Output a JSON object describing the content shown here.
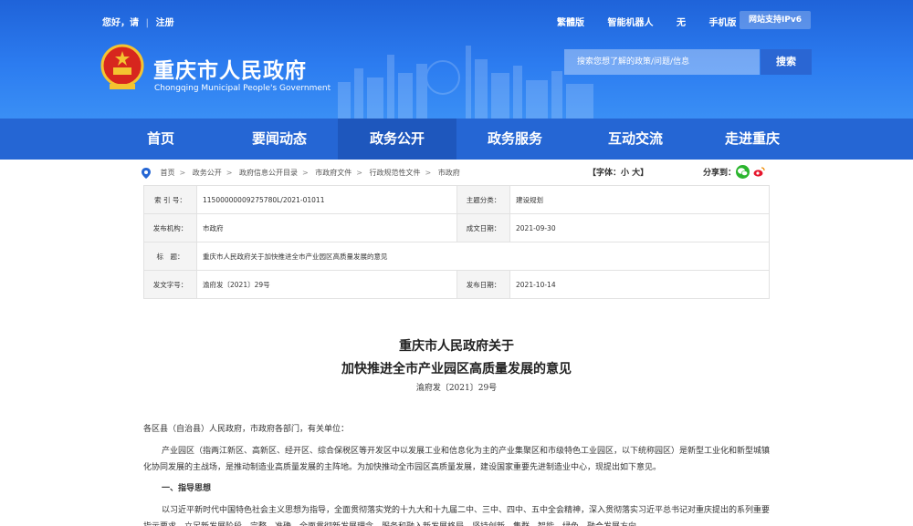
{
  "topbar": {
    "greeting": "您好，请",
    "register": "注册",
    "links": [
      "繁體版",
      "智能机器人",
      "无",
      "手机版"
    ],
    "ipv6": "网站支持IPv6"
  },
  "logo": {
    "cn": "重庆市人民政府",
    "en": "Chongqing Municipal People's Government"
  },
  "search": {
    "placeholder": "搜索您想了解的政策/问题/信息",
    "button": "搜索"
  },
  "nav": [
    "首页",
    "要闻动态",
    "政务公开",
    "政务服务",
    "互动交流",
    "走进重庆"
  ],
  "breadcrumb": [
    "首页",
    "政务公开",
    "政府信息公开目录",
    "市政府文件",
    "行政规范性文件",
    "市政府"
  ],
  "fontsize": "【字体：小 大】",
  "share_label": "分享到：",
  "meta": {
    "index_label": "索 引 号：",
    "index_value": "11500000009275780L/2021-01011",
    "topic_label": "主题分类：",
    "topic_value": "建设规划",
    "org_label": "发布机构：",
    "org_value": "市政府",
    "created_label": "成文日期：",
    "created_value": "2021-09-30",
    "title_label": "标　题：",
    "title_value": "重庆市人民政府关于加快推进全市产业园区高质量发展的意见",
    "docno_label": "发文字号：",
    "docno_value": "渝府发〔2021〕29号",
    "pub_label": "发布日期：",
    "pub_value": "2021-10-14"
  },
  "article": {
    "title1": "重庆市人民政府关于",
    "title2": "加快推进全市产业园区高质量发展的意见",
    "docno": "渝府发〔2021〕29号",
    "address": "各区县（自治县）人民政府，市政府各部门，有关单位：",
    "intro": "产业园区（指两江新区、高新区、经开区、综合保税区等开发区中以发展工业和信息化为主的产业集聚区和市级特色工业园区，以下统称园区）是新型工业化和新型城镇化协同发展的主战场，是推动制造业高质量发展的主阵地。为加快推动全市园区高质量发展，建设国家重要先进制造业中心，现提出如下意见。",
    "heading1": "一、指导思想",
    "body": "以习近平新时代中国特色社会主义思想为指导，全面贯彻落实党的十九大和十九届二中、三中、四中、五中全会精神，深入贯彻落实习近平总书记对重庆提出的系列重要指示要求，立足新发展阶段，完整、准确、全面贯彻新发展理念，服务和融入新发展格局，坚持创新、集群、智能、绿色、融合发展方向，"
  },
  "colors": {
    "header": "#2c7cf0",
    "nav": "#2566d4",
    "nav_active": "#1e57bd",
    "search_btn": "#2a66d3",
    "wechat": "#2bb52e",
    "weibo": "#e6162d"
  }
}
